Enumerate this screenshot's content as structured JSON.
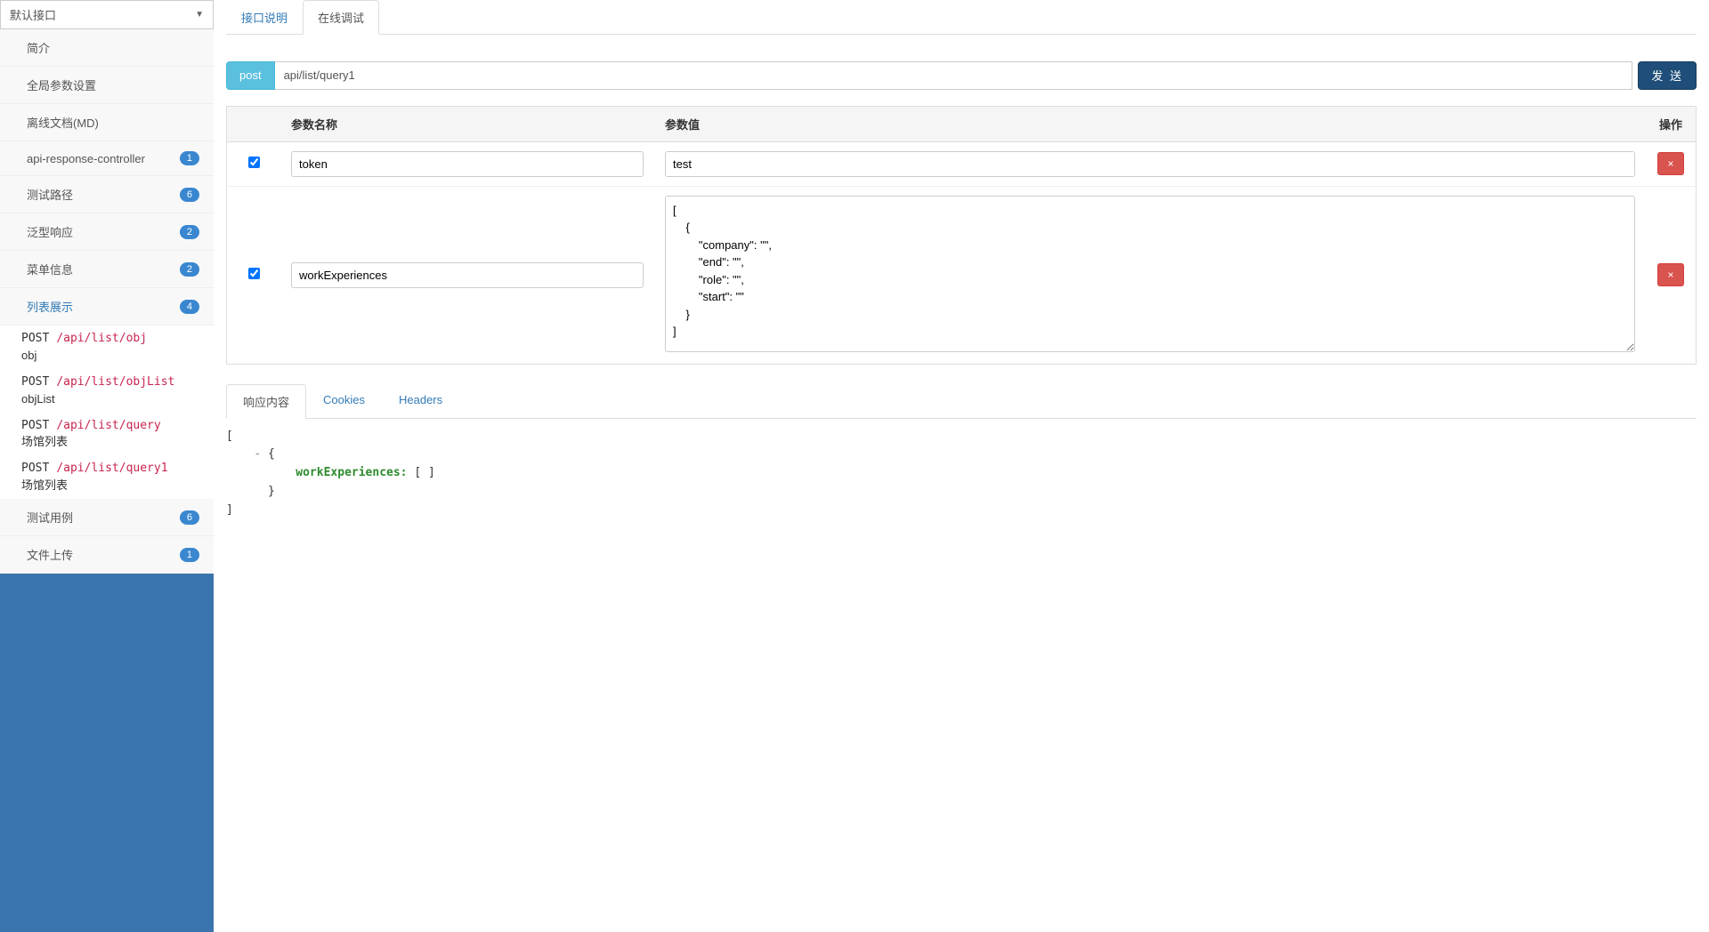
{
  "sidebar": {
    "dropdown_label": "默认接口",
    "items": [
      {
        "label": "简介",
        "badge": null,
        "active": false
      },
      {
        "label": "全局参数设置",
        "badge": null,
        "active": false
      },
      {
        "label": "离线文档(MD)",
        "badge": null,
        "active": false
      },
      {
        "label": "api-response-controller",
        "badge": "1",
        "active": false
      },
      {
        "label": "测试路径",
        "badge": "6",
        "active": false
      },
      {
        "label": "泛型响应",
        "badge": "2",
        "active": false
      },
      {
        "label": "菜单信息",
        "badge": "2",
        "active": false
      },
      {
        "label": "列表展示",
        "badge": "4",
        "active": true
      },
      {
        "label": "测试用例",
        "badge": "6",
        "active": false
      },
      {
        "label": "文件上传",
        "badge": "1",
        "active": false
      }
    ],
    "sublist": [
      {
        "method": "POST",
        "path": "/api/list/obj",
        "desc": "obj"
      },
      {
        "method": "POST",
        "path": "/api/list/objList",
        "desc": "objList"
      },
      {
        "method": "POST",
        "path": "/api/list/query",
        "desc": "场馆列表"
      },
      {
        "method": "POST",
        "path": "/api/list/query1",
        "desc": "场馆列表"
      }
    ]
  },
  "main": {
    "tabs": {
      "doc": "接口说明",
      "debug": "在线调试"
    },
    "method": "post",
    "url": "api/list/query1",
    "send_label": "发 送",
    "table": {
      "col_name": "参数名称",
      "col_value": "参数值",
      "col_op": "操作",
      "rows": [
        {
          "checked": true,
          "name": "token",
          "value": "test",
          "multiline": false
        },
        {
          "checked": true,
          "name": "workExperiences",
          "value": "[\n    {\n        \"company\": \"\",\n        \"end\": \"\",\n        \"role\": \"\",\n        \"start\": \"\"\n    }\n]",
          "multiline": true
        }
      ],
      "delete_icon": "×"
    },
    "response": {
      "tabs": {
        "body": "响应内容",
        "cookies": "Cookies",
        "headers": "Headers"
      },
      "toggle": "-",
      "brackets": {
        "open_arr": "[",
        "close_arr": "]",
        "open_obj": "{",
        "close_obj": "}"
      },
      "key": "workExperiences:",
      "empty_arr": "[ ]"
    }
  }
}
